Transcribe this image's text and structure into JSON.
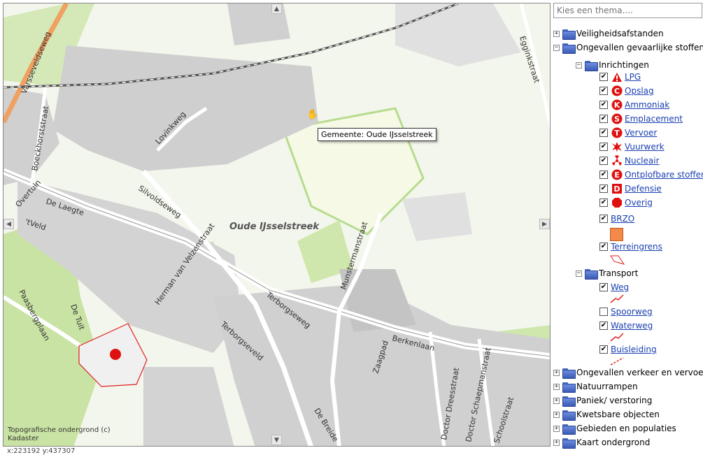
{
  "map": {
    "pan_up": "▲",
    "pan_down": "▼",
    "pan_left": "◀",
    "pan_right": "▶",
    "tooltip": "Gemeente: Oude IJsselstreek",
    "area_label": "Oude IJsselstreek",
    "attribution": "Topografische ondergrond (c) Kadaster",
    "coords": "x:223192 y:437307",
    "streets": {
      "varsseveldseweg": "Varsseveldseweg",
      "boeckhorststraat": "Boeckhorststraat",
      "lovinkweg": "Lovinkweg",
      "overtuin": "Overtuin",
      "de_laegte": "De Laegte",
      "silvoldseweg": "Silvoldseweg",
      "tveld": "'tVeld",
      "herman": "Herman van Velzenstraat",
      "paasbergplaan": "Paasbergplaan",
      "de_tuit": "De Tuit",
      "terborgseweg": "Terborgseweg",
      "terborgseveld": "Terborgseveld",
      "munstermanstraat": "Munstermanstraat",
      "berkenlaan": "Berkenlaan",
      "zaagpad": "Zaagpad",
      "de_breide": "De Breide",
      "doctor_dreesstraat": "Doctor Dreesstraat",
      "doctor_schaepmanstraat": "Doctor Schaepmanstraat",
      "schoolstraat": "Schoolstraat",
      "egginkstraat": "Egginkstraat"
    }
  },
  "panel": {
    "theme_placeholder": "Kies een thema....",
    "expand_symbol": "+",
    "collapse_symbol": "−",
    "check_mark": "✔",
    "groups": {
      "veiligheid": "Veiligheidsafstanden",
      "ongevallen_gs": "Ongevallen gevaarlijke stoffen",
      "inrichtingen": "Inrichtingen",
      "transport": "Transport",
      "ongevallen_vv": "Ongevallen verkeer en vervoer",
      "natuurrampen": "Natuurrampen",
      "paniek": "Paniek/ verstoring",
      "kwetsbare": "Kwetsbare objecten",
      "gebieden": "Gebieden en populaties",
      "kaart": "Kaart ondergrond"
    },
    "layers": {
      "lpg": "LPG",
      "opslag": "Opslag",
      "ammoniak": "Ammoniak",
      "emplacement": "Emplacement",
      "vervoer": "Vervoer",
      "vuurwerk": "Vuurwerk",
      "nucleair": "Nucleair",
      "ontplofbare": "Ontplofbare stoffen",
      "defensie": "Defensie",
      "overig": "Overig",
      "brzo": "BRZO",
      "terreingrens": "Terreingrens",
      "weg": "Weg",
      "spoorweg": "Spoorweg",
      "waterweg": "Waterweg",
      "buisleiding": "Buisleiding"
    },
    "icon_letters": {
      "opslag": "C",
      "ammoniak": "K",
      "emplacement": "S",
      "vervoer": "T",
      "ontplofbare": "E",
      "defensie": "D"
    },
    "colors": {
      "icon_red": "#e01010",
      "brzo_fill": "#f48a4a",
      "link": "#1a3fb0"
    }
  }
}
